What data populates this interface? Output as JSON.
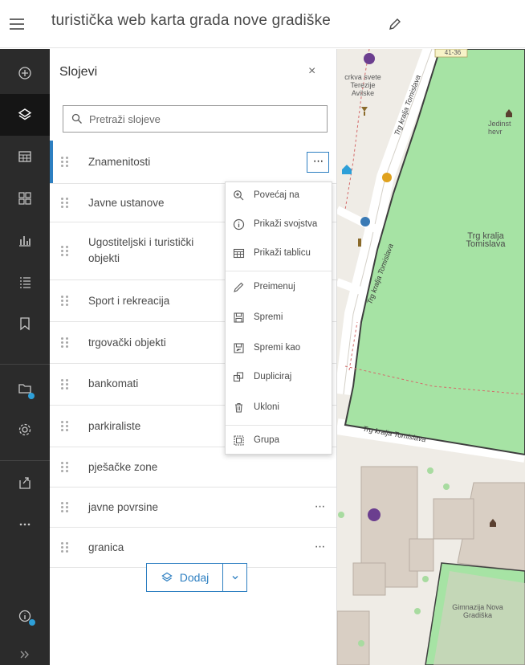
{
  "header": {
    "title": "turistička web karta grada nove gradiške"
  },
  "actionbar": {
    "items": [
      {
        "icon": "add-icon"
      },
      {
        "icon": "layers-icon",
        "active": true
      },
      {
        "icon": "table-icon"
      },
      {
        "icon": "basemap-icon"
      },
      {
        "icon": "chart-icon"
      },
      {
        "icon": "legend-icon"
      },
      {
        "icon": "bookmark-icon"
      },
      {
        "icon": "media-icon"
      },
      {
        "icon": "settings-icon"
      },
      {
        "icon": "share-icon"
      },
      {
        "icon": "more-icon"
      },
      {
        "icon": "info-icon"
      },
      {
        "icon": "expand-icon"
      }
    ]
  },
  "panel": {
    "title": "Slojevi",
    "close": "×",
    "search_placeholder": "Pretraži slojeve",
    "layers": [
      {
        "label": "Znamenitosti",
        "selected": true
      },
      {
        "label": "Javne ustanove"
      },
      {
        "label": "Ugostiteljski i turistički objekti"
      },
      {
        "label": "Sport i rekreacija"
      },
      {
        "label": "trgovački objekti"
      },
      {
        "label": "bankomati"
      },
      {
        "label": "parkiraliste"
      },
      {
        "label": "pješačke zone"
      },
      {
        "label": "javne povrsine"
      },
      {
        "label": "granica"
      }
    ],
    "more_label": "···",
    "add_label": "Dodaj"
  },
  "menu": {
    "items": [
      {
        "label": "Povećaj na",
        "icon": "zoom-to-icon"
      },
      {
        "label": "Prikaži svojstva",
        "icon": "info-icon"
      },
      {
        "label": "Prikaži tablicu",
        "icon": "table-icon"
      },
      {
        "label": "Preimenuj",
        "icon": "pencil-icon"
      },
      {
        "label": "Spremi",
        "icon": "save-icon"
      },
      {
        "label": "Spremi kao",
        "icon": "save-as-icon"
      },
      {
        "label": "Dupliciraj",
        "icon": "duplicate-icon"
      },
      {
        "label": "Ukloni",
        "icon": "trash-icon"
      },
      {
        "label": "Grupa",
        "icon": "group-icon"
      }
    ]
  },
  "map": {
    "labels": {
      "church": "crkva svete Terezije Avilske",
      "square": "Trg kralja Tomislava",
      "street": "Trg kralja Tomislava",
      "school": "Gimnazija Nova Gradiška",
      "partial_top": "Jedinst hevr",
      "address": "41-36"
    }
  },
  "colors": {
    "accent": "#2d7fc1",
    "actionbar": "#2b2b2b",
    "park": "#a6e3a4",
    "map_bg": "#efece6"
  }
}
